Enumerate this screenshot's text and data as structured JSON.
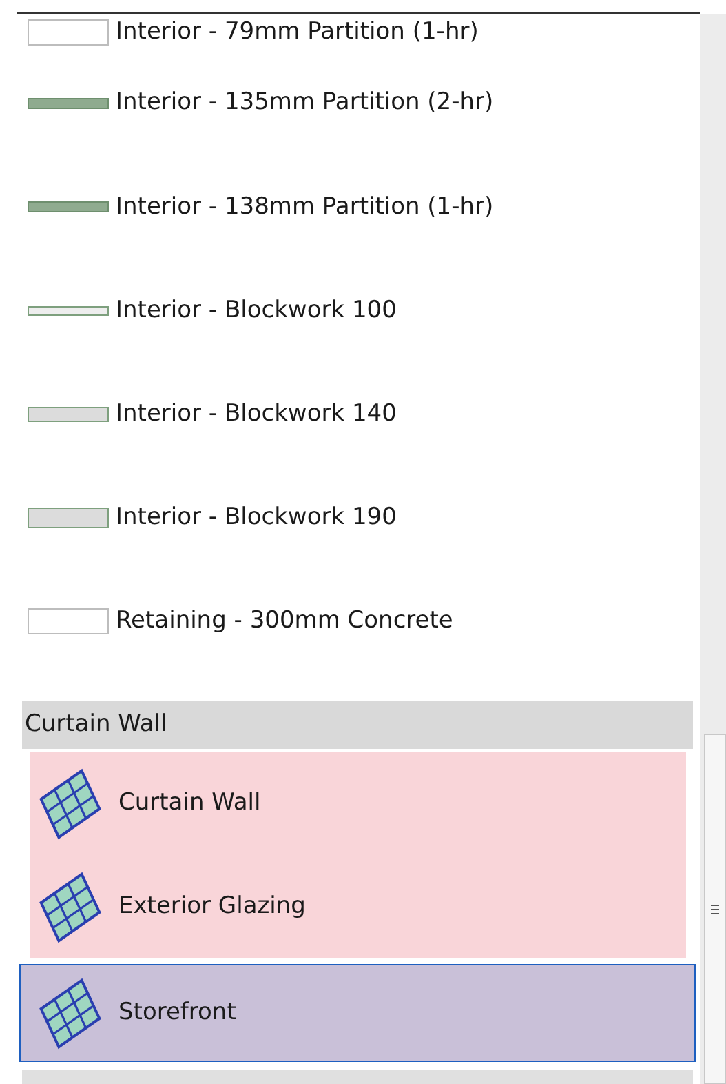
{
  "wall_types": [
    {
      "label": "Interior - 79mm Partition (1-hr)",
      "kind": "plain"
    },
    {
      "label": "Interior - 135mm Partition (2-hr)",
      "kind": "band"
    },
    {
      "label": "Interior - 138mm Partition (1-hr)",
      "kind": "band"
    },
    {
      "label": "Interior - Blockwork 100",
      "kind": "thin"
    },
    {
      "label": "Interior - Blockwork 140",
      "kind": "medium"
    },
    {
      "label": "Interior - Blockwork 190",
      "kind": "thick"
    },
    {
      "label": "Retaining - 300mm Concrete",
      "kind": "plain"
    }
  ],
  "group": {
    "title": "Curtain Wall",
    "items": [
      {
        "label": "Curtain Wall",
        "highlighted": true,
        "selected": false
      },
      {
        "label": "Exterior Glazing",
        "highlighted": true,
        "selected": false
      },
      {
        "label": "Storefront",
        "highlighted": true,
        "selected": true
      }
    ]
  }
}
